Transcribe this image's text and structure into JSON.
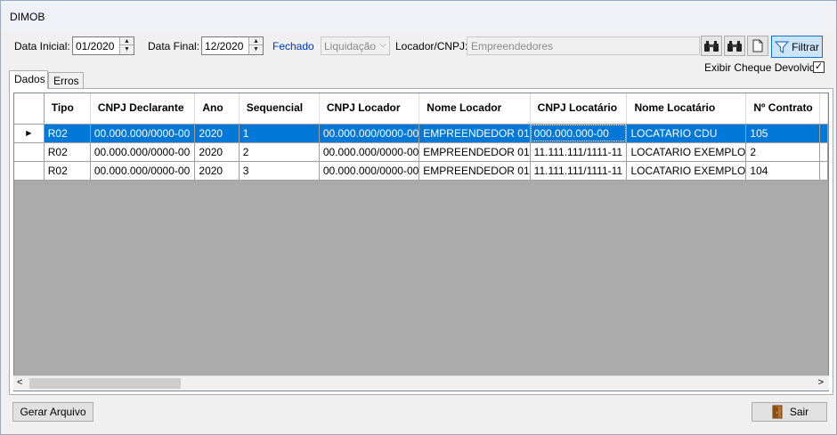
{
  "window": {
    "title": "DIMOB"
  },
  "filters": {
    "data_inicial_label": "Data Inicial:",
    "data_inicial_value": "01/2020",
    "data_final_label": "Data Final:",
    "data_final_value": "12/2020",
    "fechado_label": "Fechado",
    "liquidacao_value": "Liquidação",
    "locador_label": "Locador/CNPJ:",
    "locador_value": "Empreendedores",
    "filtrar_label": "Filtrar",
    "exibir_cheque_label": "Exibir Cheque Devolvido",
    "exibir_cheque_checked": true
  },
  "tabs": [
    {
      "label": "Dados",
      "active": true
    },
    {
      "label": "Erros",
      "active": false
    }
  ],
  "grid": {
    "columns": [
      "Tipo",
      "CNPJ Declarante",
      "Ano",
      "Sequencial",
      "CNPJ Locador",
      "Nome Locador",
      "CNPJ Locatário",
      "Nome Locatário",
      "Nº Contrato"
    ],
    "rows": [
      {
        "tipo": "R02",
        "cnpj_declarante": "00.000.000/0000-00",
        "ano": "2020",
        "sequencial": "1",
        "cnpj_locador": "00.000.000/0000-00",
        "nome_locador": "EMPREENDEDOR 01",
        "cnpj_locatario": "000.000.000-00",
        "nome_locatario": "LOCATARIO CDU",
        "contrato": "105",
        "selected": true
      },
      {
        "tipo": "R02",
        "cnpj_declarante": "00.000.000/0000-00",
        "ano": "2020",
        "sequencial": "2",
        "cnpj_locador": "00.000.000/0000-00",
        "nome_locador": "EMPREENDEDOR 01",
        "cnpj_locatario": "11.111.111/1111-11",
        "nome_locatario": "LOCATARIO EXEMPLO",
        "contrato": "2",
        "selected": false
      },
      {
        "tipo": "R02",
        "cnpj_declarante": "00.000.000/0000-00",
        "ano": "2020",
        "sequencial": "3",
        "cnpj_locador": "00.000.000/0000-00",
        "nome_locador": "EMPREENDEDOR 01",
        "cnpj_locatario": "11.111.111/1111-11",
        "nome_locatario": "LOCATARIO EXEMPLO",
        "contrato": "104",
        "selected": false
      }
    ]
  },
  "footer": {
    "gerar_label": "Gerar Arquivo",
    "sair_label": "Sair"
  },
  "colors": {
    "selection": "#0078d7",
    "fechado": "#0033cc",
    "grid_empty": "#ababab"
  }
}
